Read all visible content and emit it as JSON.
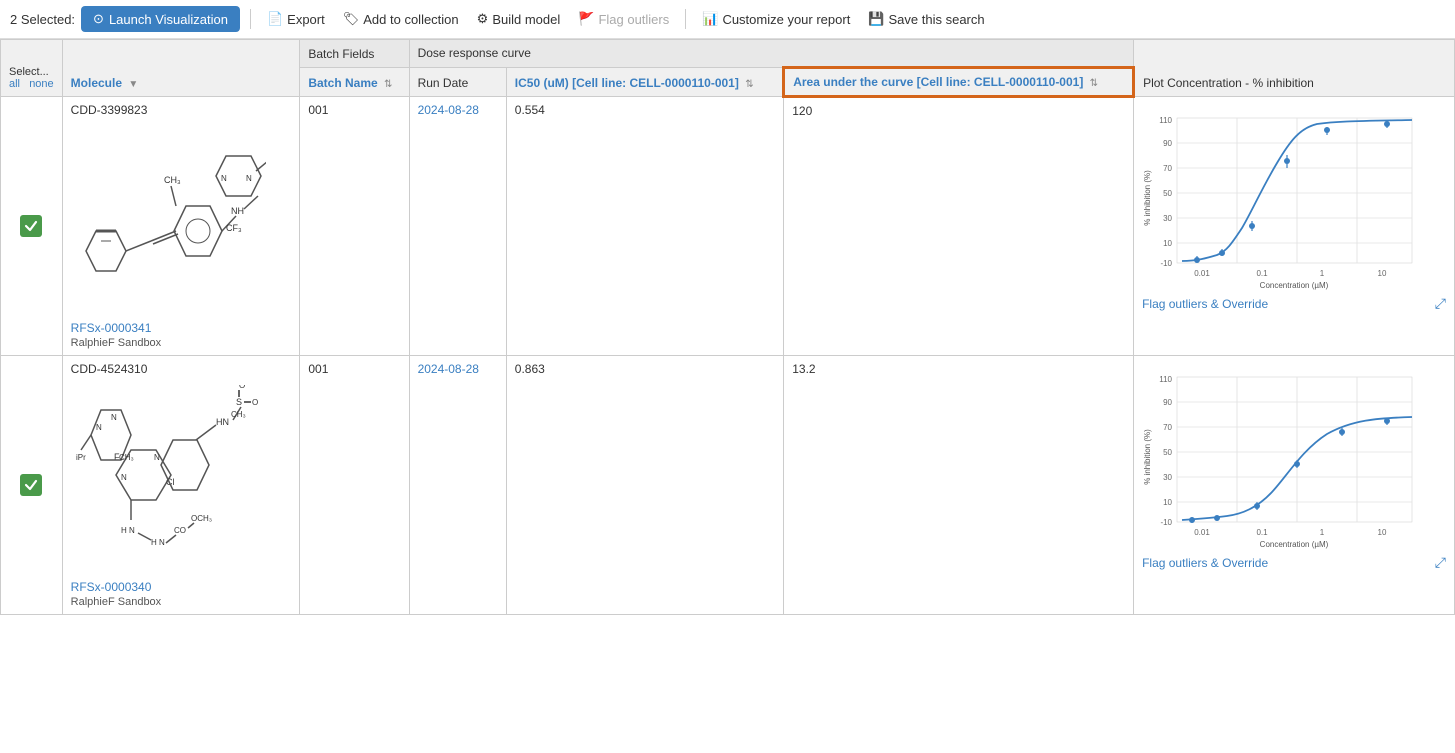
{
  "toolbar": {
    "selected_label": "2 Selected:",
    "launch_btn": "Launch Visualization",
    "export_btn": "Export",
    "add_collection_btn": "Add to collection",
    "build_model_btn": "Build model",
    "flag_outliers_btn": "Flag outliers",
    "customize_report_btn": "Customize your report",
    "save_search_btn": "Save this search"
  },
  "table": {
    "col_select_header": "Select...",
    "col_select_all": "all",
    "col_select_none": "none",
    "col_molecule_header": "Molecule",
    "col_batch_group": "Batch Fields",
    "col_dose_group": "Dose response curve",
    "col_batch_name_header": "Batch Name",
    "col_run_date_header": "Run Date",
    "col_ic50_header": "IC50 (uM) [Cell line: CELL-0000110-001]",
    "col_auc_header": "Area under the curve [Cell line: CELL-0000110-001]",
    "col_plot_header": "Plot Concentration - % inhibition",
    "rows": [
      {
        "id": 1,
        "checked": true,
        "cdd_id": "CDD-3399823",
        "molecule_link": "RFSx-0000341",
        "sandbox": "RalphieF Sandbox",
        "batch_name": "001",
        "run_date": "2024-08-28",
        "ic50": "0.554",
        "auc": "120",
        "flag_link": "Flag outliers & Override",
        "plot_type": "sigmoidal"
      },
      {
        "id": 2,
        "checked": true,
        "cdd_id": "CDD-4524310",
        "molecule_link": "RFSx-0000340",
        "sandbox": "RalphieF Sandbox",
        "batch_name": "001",
        "run_date": "2024-08-28",
        "ic50": "0.863",
        "auc": "13.2",
        "flag_link": "Flag outliers & Override",
        "plot_type": "partial"
      }
    ]
  },
  "icons": {
    "launch": "⊙",
    "export": "📄",
    "collection": "🏷",
    "model": "⚙",
    "flag": "🚩",
    "report": "📊",
    "save": "💾",
    "sort": "⇅",
    "sort_down": "▼",
    "expand": "⤢",
    "checkmark": "✓"
  },
  "colors": {
    "accent_blue": "#3a7fc1",
    "orange_border": "#d4651a",
    "checked_green": "#4a9a4a",
    "header_bg": "#f0f0f0",
    "group_bg": "#e8e8e8"
  }
}
